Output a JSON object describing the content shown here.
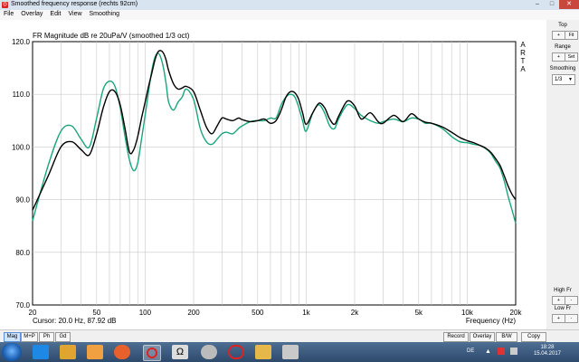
{
  "window": {
    "title": "Smoothed frequency response (rechts 92cm)"
  },
  "menu": [
    "File",
    "Overlay",
    "Edit",
    "View",
    "Smoothing"
  ],
  "chart_data": {
    "type": "line",
    "title": "FR Magnitude dB re 20uPa/V (smoothed 1/3 oct)",
    "watermark": "ARTA",
    "xlabel": "Frequency (Hz)",
    "ylabel": "",
    "xscale": "log",
    "xlim": [
      20,
      20000
    ],
    "ylim": [
      70,
      120
    ],
    "x_ticks": [
      "20",
      "50",
      "100",
      "200",
      "500",
      "1k",
      "2k",
      "5k",
      "10k",
      "20k"
    ],
    "y_ticks": [
      "120.0",
      "110.0",
      "100.0",
      "90.0",
      "80.0",
      "70.0"
    ],
    "grid": true,
    "cursor_text": "Cursor: 20.0 Hz, 87.92 dB",
    "series": [
      {
        "color": "#000000",
        "x": [
          20,
          25,
          30,
          35,
          40,
          45,
          50,
          55,
          60,
          65,
          70,
          75,
          80,
          85,
          90,
          95,
          100,
          105,
          110,
          115,
          120,
          125,
          130,
          135,
          140,
          150,
          160,
          170,
          180,
          200,
          220,
          240,
          260,
          280,
          300,
          320,
          350,
          380,
          400,
          450,
          500,
          550,
          600,
          650,
          700,
          750,
          800,
          850,
          900,
          950,
          1000,
          1100,
          1200,
          1300,
          1400,
          1500,
          1600,
          1800,
          2000,
          2200,
          2500,
          2800,
          3000,
          3500,
          4000,
          4500,
          5000,
          5500,
          6000,
          7000,
          8000,
          9000,
          10000,
          11000,
          12000,
          13000,
          14000,
          15000,
          16000,
          17000,
          18000,
          19000,
          20000
        ],
        "values": [
          88.0,
          94.5,
          100.0,
          101.0,
          99.5,
          98.5,
          102.5,
          107.5,
          110.5,
          110.5,
          108.0,
          103.5,
          99.0,
          99.5,
          102.0,
          105.5,
          108.5,
          111.5,
          114.0,
          116.5,
          118.0,
          118.3,
          117.8,
          116.5,
          114.5,
          112.0,
          111.0,
          111.2,
          111.5,
          110.5,
          107.0,
          103.8,
          102.5,
          104.0,
          105.5,
          105.3,
          105.0,
          105.5,
          105.2,
          104.8,
          105.0,
          105.3,
          104.5,
          105.0,
          107.0,
          109.5,
          110.5,
          110.3,
          109.0,
          106.5,
          104.3,
          106.5,
          108.3,
          107.5,
          105.3,
          104.3,
          106.0,
          108.7,
          107.8,
          105.3,
          106.5,
          104.8,
          104.5,
          106.0,
          104.8,
          106.3,
          105.3,
          104.7,
          104.5,
          103.8,
          102.8,
          101.8,
          101.2,
          100.8,
          100.3,
          99.8,
          99.0,
          97.8,
          96.5,
          94.5,
          92.5,
          91.0,
          90.0
        ]
      },
      {
        "color": "#1aa67c",
        "x": [
          20,
          25,
          30,
          35,
          40,
          45,
          50,
          55,
          60,
          65,
          70,
          75,
          80,
          85,
          90,
          95,
          100,
          105,
          110,
          115,
          120,
          125,
          130,
          135,
          140,
          150,
          160,
          170,
          180,
          200,
          220,
          240,
          260,
          280,
          300,
          320,
          350,
          380,
          400,
          450,
          500,
          550,
          600,
          650,
          700,
          750,
          800,
          850,
          900,
          950,
          1000,
          1100,
          1200,
          1300,
          1400,
          1500,
          1600,
          1800,
          2000,
          2200,
          2500,
          2800,
          3000,
          3500,
          4000,
          4500,
          5000,
          5500,
          6000,
          7000,
          8000,
          9000,
          10000,
          11000,
          12000,
          13000,
          14000,
          15000,
          16000,
          17000,
          18000,
          19000,
          20000
        ],
        "values": [
          86.0,
          96.5,
          103.0,
          104.0,
          101.5,
          100.0,
          105.5,
          111.0,
          112.5,
          111.5,
          107.5,
          102.0,
          97.5,
          95.5,
          97.0,
          101.5,
          106.0,
          110.5,
          114.5,
          117.0,
          117.8,
          117.0,
          115.0,
          112.0,
          108.5,
          107.0,
          108.5,
          109.5,
          111.0,
          109.0,
          103.5,
          101.0,
          100.5,
          101.5,
          102.5,
          102.8,
          102.5,
          103.5,
          104.0,
          104.8,
          105.0,
          105.0,
          105.5,
          105.5,
          108.0,
          109.5,
          110.0,
          109.5,
          107.5,
          105.0,
          103.0,
          106.5,
          108.0,
          106.5,
          104.0,
          103.5,
          105.5,
          108.0,
          107.3,
          106.0,
          105.0,
          104.5,
          104.8,
          105.3,
          104.8,
          105.5,
          105.3,
          104.5,
          104.5,
          103.5,
          102.0,
          101.0,
          100.8,
          100.5,
          100.3,
          99.7,
          98.8,
          97.3,
          96.0,
          93.5,
          90.5,
          88.0,
          85.5
        ]
      }
    ]
  },
  "right_panel": {
    "top_label": "Top",
    "fit_label": "Fit",
    "range_label": "Range",
    "set_label": "Set",
    "smoothing_label": "Smoothing",
    "smoothing_value": "1/3",
    "highfr_label": "High Fr",
    "lowfr_label": "Low Fr",
    "up_glyph": "+",
    "down_glyph": "-"
  },
  "bottom_tabs": [
    "Mag",
    "M+P",
    "Ph",
    "Gd"
  ],
  "bottom_buttons": [
    "Record",
    "Overlay",
    "B/W",
    "Copy"
  ],
  "taskbar": {
    "lang": "DE",
    "time": "18:28",
    "date": "15.04.2017",
    "apps": [
      "ie",
      "folder",
      "media-player",
      "firefox",
      "arta",
      "ohm",
      "settings",
      "recorder",
      "files",
      "utility"
    ]
  }
}
